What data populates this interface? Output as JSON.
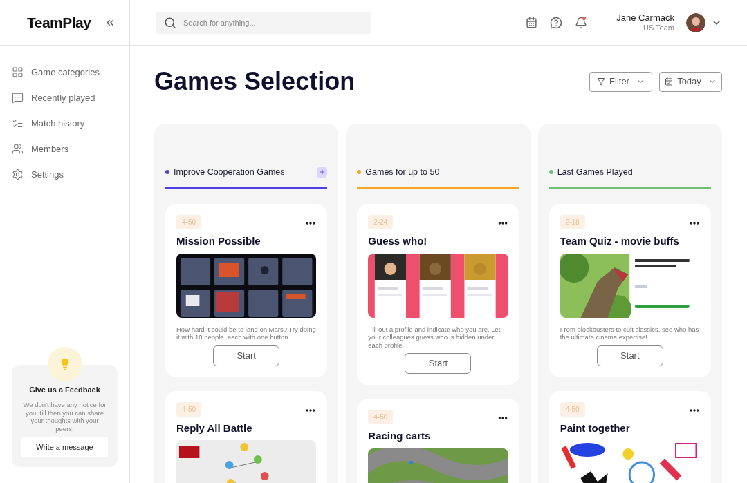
{
  "brand": {
    "name": "TeamPlay"
  },
  "search": {
    "placeholder": "Search for anything..."
  },
  "header": {
    "notification_unread": true
  },
  "user": {
    "name": "Jane Carmack",
    "team": "US Team"
  },
  "nav": [
    {
      "label": "Game categories"
    },
    {
      "label": "Recently played"
    },
    {
      "label": "Match history"
    },
    {
      "label": "Members"
    },
    {
      "label": "Settings"
    }
  ],
  "feedback": {
    "title": "Give us a Feedback",
    "text": "We don't have any notice for you, till then you can share your thoughts with your peers.",
    "button": "Write a message"
  },
  "page": {
    "title": "Games Selection",
    "filter": "Filter",
    "date": "Today"
  },
  "columns": [
    {
      "title": "Improve Cooperation Games",
      "color": "#4f3ee0",
      "addable": true,
      "cards": [
        {
          "tag": "4-50",
          "title": "Mission Possible",
          "description": "How hard it could be to land on Mars? Try doing it with 10 people, each with one button.",
          "button": "Start"
        },
        {
          "tag": "4-50",
          "title": "Reply All Battle"
        }
      ]
    },
    {
      "title": "Games for up to 50",
      "color": "#f5a623",
      "addable": false,
      "cards": [
        {
          "tag": "2-24",
          "title": "Guess who!",
          "description": "Fill out a profile and indicate who you are. Let your colleagues guess who is hidden under each profile.",
          "button": "Start"
        },
        {
          "tag": "4-50",
          "title": "Racing carts"
        }
      ]
    },
    {
      "title": "Last Games Played",
      "color": "#6fbf73",
      "addable": false,
      "cards": [
        {
          "tag": "2-18",
          "title": "Team Quiz - movie buffs",
          "description": "From blockbusters to cult classics, see who has the ultimate cinema expertise!",
          "button": "Start"
        },
        {
          "tag": "4-50",
          "title": "Paint together"
        }
      ]
    }
  ]
}
